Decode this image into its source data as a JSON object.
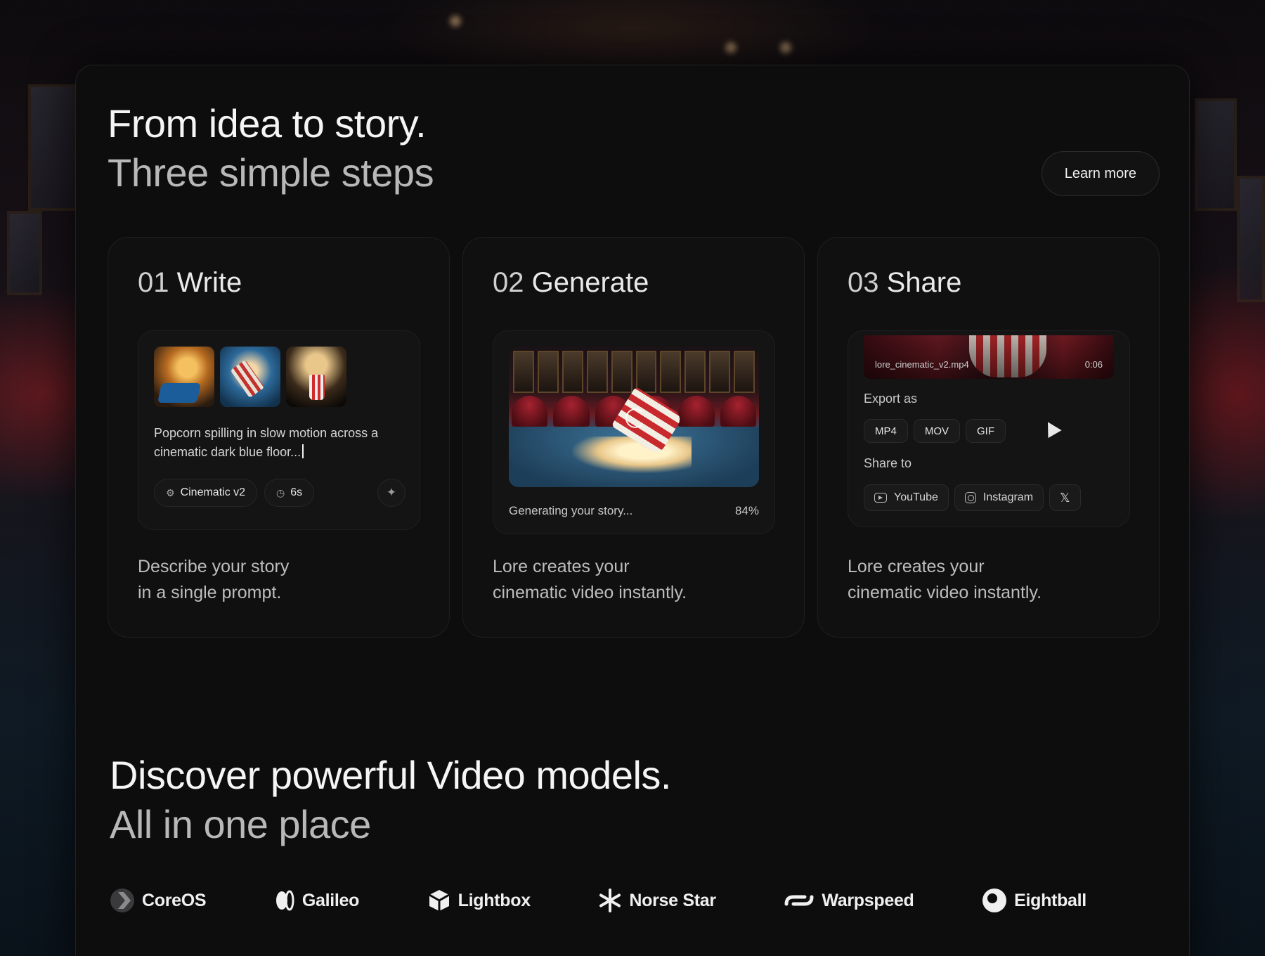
{
  "hero": {
    "title_line1": "From idea to story.",
    "title_line2": "Three simple steps",
    "learn_more": "Learn more"
  },
  "steps": [
    {
      "num": "01",
      "title": "Write",
      "prompt": "Popcorn spilling in slow motion across a cinematic dark blue floor...",
      "chips": [
        {
          "icon": "model-icon",
          "label": "Cinematic v2"
        },
        {
          "icon": "clock-icon",
          "label": "6s"
        }
      ],
      "desc_line1": "Describe your story",
      "desc_line2": "in a single prompt."
    },
    {
      "num": "02",
      "title": "Generate",
      "status": "Generating your story...",
      "progress": "84%",
      "desc_line1": "Lore creates your",
      "desc_line2": "cinematic video instantly."
    },
    {
      "num": "03",
      "title": "Share",
      "clip_name": "lore_cinematic_v2.mp4",
      "clip_time": "0:06",
      "export_label": "Export as",
      "formats": [
        "MP4",
        "MOV",
        "GIF"
      ],
      "share_label": "Share to",
      "platforms": [
        "YouTube",
        "Instagram"
      ],
      "desc_line1": "Lore creates your",
      "desc_line2": "cinematic video instantly."
    }
  ],
  "discover": {
    "title_line1": "Discover powerful Video models.",
    "title_line2": "All in one place"
  },
  "logos": [
    "CoreOS",
    "Galileo",
    "Lightbox",
    "Norse Star",
    "Warpspeed",
    "Eightball"
  ],
  "colors": {
    "panel_bg": "#0d0d0e",
    "card_bg": "#101011",
    "text_primary": "#f5f5f5",
    "text_secondary": "#b8b8b8"
  }
}
